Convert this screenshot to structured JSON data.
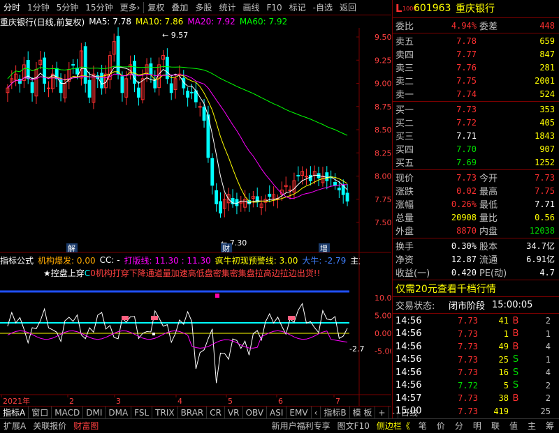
{
  "toolbar": {
    "items": [
      "分时",
      "1分钟",
      "5分钟",
      "15分钟",
      "更多›",
      "复权",
      "叠加",
      "多股",
      "统计",
      "画线",
      "F10",
      "标记",
      "-自选",
      "返回"
    ]
  },
  "kline_title": {
    "stock": "重庆银行(日线,前复权)",
    "ma5": "MA5: 7.78",
    "ma10": "MA10: 7.86",
    "ma20": "MA20: 7.92",
    "ma60": "MA60: 7.92"
  },
  "price_axis": [
    "9.50",
    "9.25",
    "9.00",
    "8.75",
    "8.50",
    "8.25",
    "8.00",
    "7.75",
    "7.50"
  ],
  "price_annotations": {
    "high": "9.57",
    "low": "7.30"
  },
  "markers": {
    "jie": "解",
    "cai": "财",
    "zeng": "增"
  },
  "indicator_title": {
    "name": "指标公式",
    "jigou": "机构爆发: 0.00",
    "cc": "CC: -",
    "daban": "打版线: 11.30 : 11.30",
    "fengniu": "疯牛初现预警线: 3.00",
    "daniu": "大牛: -2.79",
    "zhuli": "主力"
  },
  "indicator_sub": {
    "star": "★控盘上穿",
    "cyan_text": "C",
    "red_text": "0机构打穿下降通道量加速高低盘密集密集盘拉高边拉边出货!!"
  },
  "ind_axis": [
    "10.00",
    "5.00",
    "0.00",
    "-5.00"
  ],
  "ind_last": "-2.7",
  "months": [
    "2021年",
    "2",
    "3",
    "4",
    "5",
    "6",
    "7"
  ],
  "bottom_tabs": [
    "指标A",
    "窗口",
    "MACD",
    "DMI",
    "DMA",
    "FSL",
    "TRIX",
    "BRAR",
    "CR",
    "VR",
    "OBV",
    "ASI",
    "EMV",
    "‹",
    "指标B",
    "模 板",
    "+",
    "-",
    "日线"
  ],
  "status_bar": {
    "left": [
      "扩展A",
      "关联报价",
      "财富图"
    ],
    "right": [
      "新用户福利专享",
      "图文F10",
      "侧边栏《",
      "笔",
      "价",
      "分",
      "明",
      "联",
      "值",
      "主",
      "筹"
    ]
  },
  "quote": {
    "code": "601963",
    "name": "重庆银行",
    "weibi_label": "委比",
    "weibi": "4.94%",
    "weicha_label": "委差",
    "weicha": "448",
    "asks": [
      {
        "label": "卖五",
        "price": "7.78",
        "vol": "659"
      },
      {
        "label": "卖四",
        "price": "7.77",
        "vol": "847"
      },
      {
        "label": "卖三",
        "price": "7.76",
        "vol": "281"
      },
      {
        "label": "卖二",
        "price": "7.75",
        "vol": "2001"
      },
      {
        "label": "卖一",
        "price": "7.74",
        "vol": "524"
      }
    ],
    "bids": [
      {
        "label": "买一",
        "price": "7.73",
        "vol": "353"
      },
      {
        "label": "买二",
        "price": "7.72",
        "vol": "405"
      },
      {
        "label": "买三",
        "price": "7.71",
        "vol": "1843"
      },
      {
        "label": "买四",
        "price": "7.70",
        "vol": "907"
      },
      {
        "label": "买五",
        "price": "7.69",
        "vol": "1252"
      }
    ],
    "stats": [
      {
        "l1": "现价",
        "v1": "7.73",
        "c1": "red",
        "l2": "今开",
        "v2": "7.73",
        "c2": "red"
      },
      {
        "l1": "涨跌",
        "v1": "0.02",
        "c1": "red",
        "l2": "最高",
        "v2": "7.75",
        "c2": "red"
      },
      {
        "l1": "涨幅",
        "v1": "0.26%",
        "c1": "red",
        "l2": "最低",
        "v2": "7.71",
        "c2": "white"
      },
      {
        "l1": "总量",
        "v1": "20908",
        "c1": "yellow",
        "l2": "量比",
        "v2": "0.56",
        "c2": "yellow"
      },
      {
        "l1": "外盘",
        "v1": "8870",
        "c1": "red",
        "l2": "内盘",
        "v2": "12038",
        "c2": "green"
      }
    ],
    "stats2": [
      {
        "l1": "换手",
        "v1": "0.30%",
        "l2": "股本",
        "v2": "34.7亿"
      },
      {
        "l1": "净资",
        "v1": "12.87",
        "l2": "流通",
        "v2": "6.91亿"
      },
      {
        "l1": "收益(一)",
        "v1": "0.420",
        "l2": "PE(动)",
        "v2": "4.7"
      }
    ],
    "promo": "仅需20元查看千档行情",
    "trade_status_label": "交易状态:",
    "trade_status": "闭市阶段",
    "trade_time": "15:00:05",
    "ticks": [
      {
        "t": "14:56",
        "p": "7.73",
        "v": "41",
        "bs": "B",
        "n": "2"
      },
      {
        "t": "14:56",
        "p": "7.73",
        "v": "1",
        "bs": "B",
        "n": "1"
      },
      {
        "t": "14:56",
        "p": "7.73",
        "v": "49",
        "bs": "B",
        "n": "4"
      },
      {
        "t": "14:56",
        "p": "7.73",
        "v": "25",
        "bs": "S",
        "n": "1"
      },
      {
        "t": "14:56",
        "p": "7.73",
        "v": "16",
        "bs": "S",
        "n": "4"
      },
      {
        "t": "14:56",
        "p": "7.72",
        "v": "5",
        "bs": "S",
        "n": "2"
      },
      {
        "t": "14:57",
        "p": "7.73",
        "v": "38",
        "bs": "B",
        "n": "2"
      },
      {
        "t": "15:00",
        "p": "7.73",
        "v": "419",
        "bs": "",
        "n": "25"
      }
    ]
  }
}
